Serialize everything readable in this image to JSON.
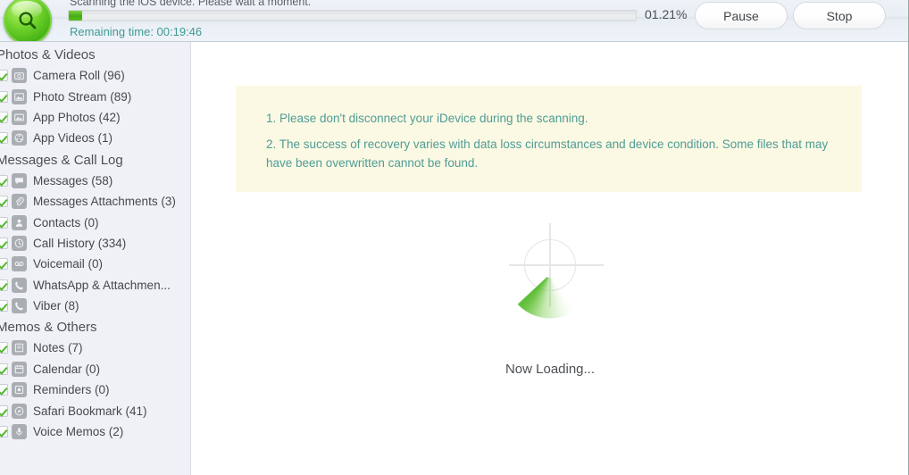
{
  "header": {
    "logo_icon": "magnifier-icon",
    "status_text": "Scanning the iOS device. Please wait a moment.",
    "remaining_label": "Remaining time: 00:19:46",
    "percent": "01.21%",
    "progress_value": 1.21,
    "pause_label": "Pause",
    "stop_label": "Stop"
  },
  "sidebar": {
    "sections": [
      {
        "title": "Photos & Videos",
        "items": [
          {
            "label": "Camera Roll (96)",
            "icon": "camera-icon",
            "checked": true
          },
          {
            "label": "Photo Stream (89)",
            "icon": "photo-icon",
            "checked": true
          },
          {
            "label": "App Photos (42)",
            "icon": "app-photo-icon",
            "checked": true
          },
          {
            "label": "App Videos (1)",
            "icon": "film-icon",
            "checked": true
          }
        ]
      },
      {
        "title": "Messages & Call Log",
        "items": [
          {
            "label": "Messages (58)",
            "icon": "message-bubble-icon",
            "checked": true
          },
          {
            "label": "Messages Attachments (3)",
            "icon": "paperclip-icon",
            "checked": true
          },
          {
            "label": "Contacts (0)",
            "icon": "person-icon",
            "checked": true
          },
          {
            "label": "Call History (334)",
            "icon": "clock-icon",
            "checked": true
          },
          {
            "label": "Voicemail (0)",
            "icon": "voicemail-icon",
            "checked": true
          },
          {
            "label": "WhatsApp & Attachmen...",
            "icon": "phone-icon",
            "checked": true
          },
          {
            "label": "Viber (8)",
            "icon": "phone-icon",
            "checked": true
          }
        ]
      },
      {
        "title": "Memos & Others",
        "items": [
          {
            "label": "Notes (7)",
            "icon": "note-icon",
            "checked": true
          },
          {
            "label": "Calendar (0)",
            "icon": "calendar-icon",
            "checked": true
          },
          {
            "label": "Reminders (0)",
            "icon": "reminder-icon",
            "checked": true
          },
          {
            "label": "Safari Bookmark (41)",
            "icon": "compass-icon",
            "checked": true
          },
          {
            "label": "Voice Memos (2)",
            "icon": "microphone-icon",
            "checked": true
          }
        ]
      }
    ]
  },
  "content": {
    "notice_lines": [
      "1. Please don't disconnect your iDevice during the scanning.",
      "2. The success of recovery varies with data loss circumstances and device condition. Some files that may have been overwritten cannot be found."
    ],
    "loading_text": "Now Loading...",
    "spinner_icon": "radar-sweep-icon"
  },
  "colors": {
    "accent_green": "#53b62b",
    "teal_text": "#3f9a93",
    "notice_bg": "#fbf9e3",
    "sidebar_bg": "#f0f1f6"
  }
}
